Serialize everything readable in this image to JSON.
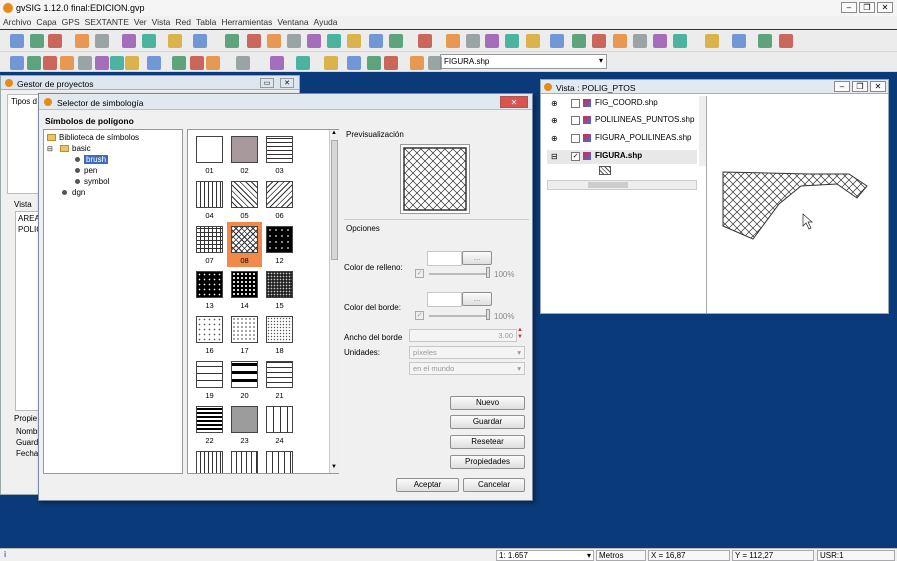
{
  "app": {
    "title": "gvSIG 1.12.0 final:EDICION.gvp"
  },
  "menu": [
    "Archivo",
    "Capa",
    "GPS",
    "SEXTANTE",
    "Ver",
    "Vista",
    "Red",
    "Tabla",
    "Herramientas",
    "Ventana",
    "Ayuda"
  ],
  "layer_combo": {
    "value": "FIGURA.shp"
  },
  "project_manager": {
    "title": "Gestor de proyectos",
    "tipos": "Tipos d",
    "vista_label": "Vista",
    "items": [
      "AREA",
      "POLIG"
    ],
    "props": [
      "Propie",
      "Nombr",
      "Guard",
      "Fecha"
    ]
  },
  "symbology": {
    "title": "Selector de simbología",
    "section": "Símbolos de polígono",
    "tree": {
      "root": "Biblioteca de símbolos",
      "basic": "basic",
      "children": [
        "brush",
        "pen",
        "symbol"
      ],
      "dgn": "dgn"
    },
    "swatches": [
      "01",
      "02",
      "03",
      "04",
      "05",
      "06",
      "07",
      "08",
      "12",
      "13",
      "14",
      "15",
      "16",
      "17",
      "18",
      "19",
      "20",
      "21",
      "22",
      "23",
      "24"
    ],
    "preview_label": "Previsualización",
    "options_label": "Opciones",
    "fill_color_label": "Color de relleno:",
    "fill_pct": "100%",
    "border_color_label": "Color del borde:",
    "border_pct": "100%",
    "border_width_label": "Ancho del borde",
    "border_width": "3.00",
    "units_label": "Unidades:",
    "units": "píxeles",
    "units_ref": "en el mundo",
    "dots": "...",
    "buttons": {
      "new": "Nuevo",
      "save": "Guardar",
      "reset": "Resetear",
      "props": "Propiedades",
      "accept": "Aceptar",
      "cancel": "Cancelar"
    }
  },
  "view_window": {
    "title": "Vista : POLIG_PTOS",
    "layers": [
      "FIG_COORD.shp",
      "POLILINEAS_PUNTOS.shp",
      "FIGURA_POLILINEAS.shp",
      "FIGURA.shp"
    ]
  },
  "status": {
    "scale": "1: 1.657",
    "units": "Metros",
    "x": "X = 16,87",
    "y": "Y = 112,27",
    "usr": "USR:1",
    "info": "i"
  },
  "colors": {
    "accent": "#3d6cbf",
    "selected_swatch": "#f08a4b",
    "desktop": "#0b3a7a"
  }
}
